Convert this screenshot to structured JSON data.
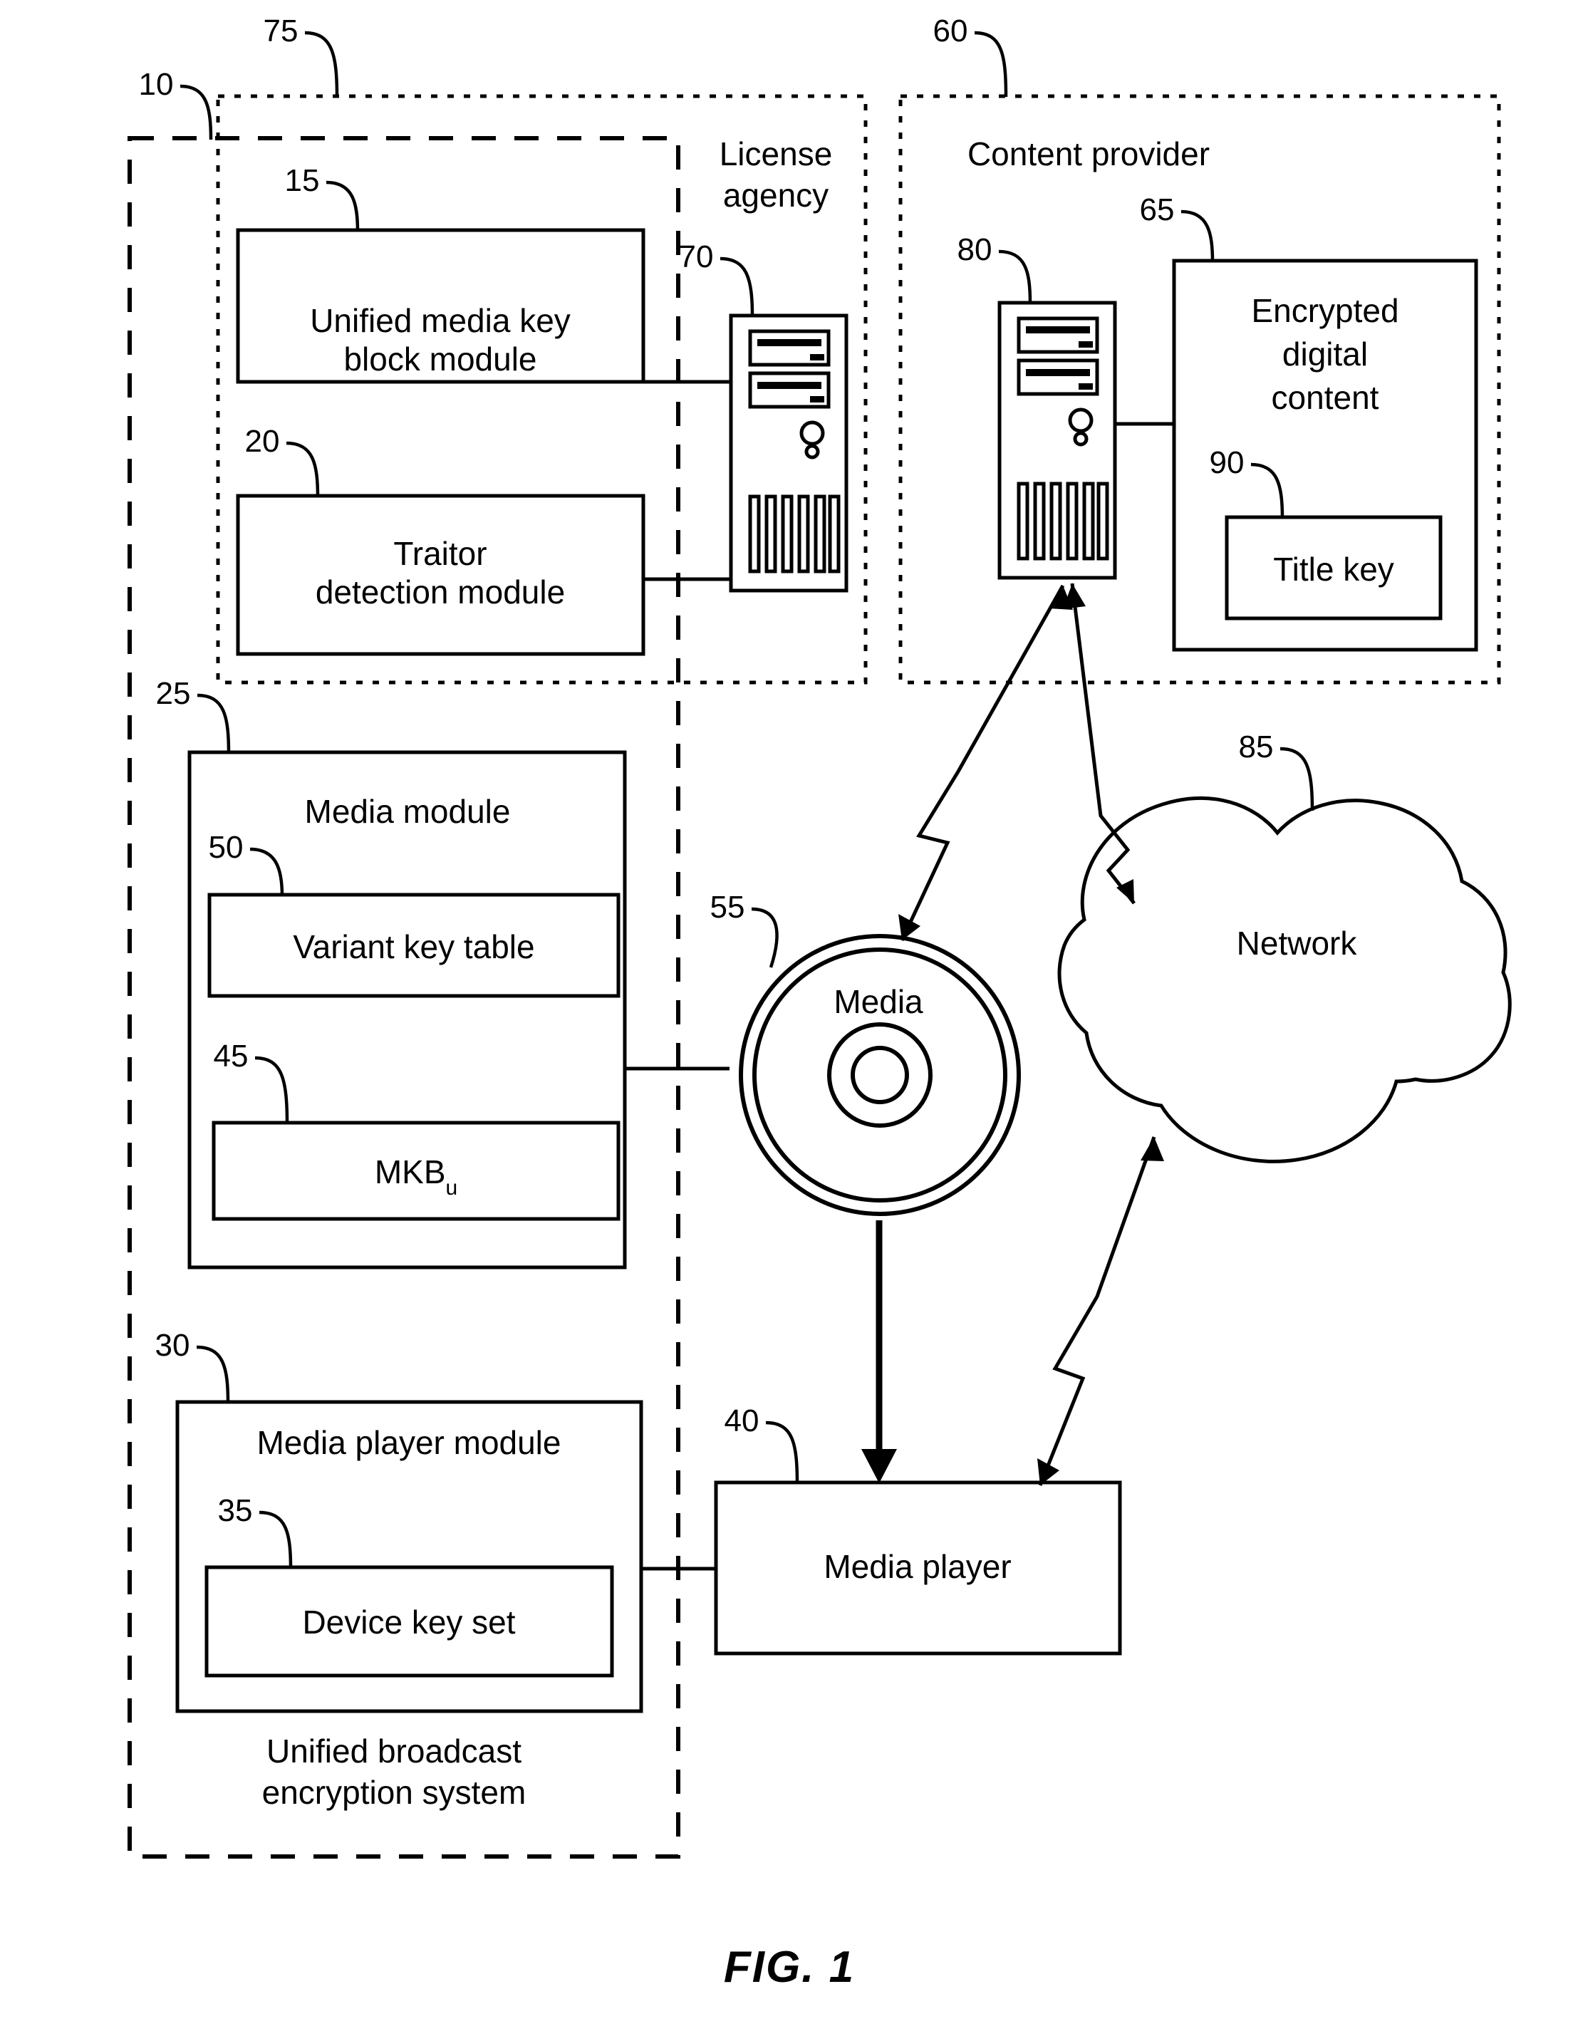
{
  "figure": {
    "caption": "FIG. 1"
  },
  "regions": {
    "system": {
      "ref": "10",
      "label_line1": "Unified broadcast",
      "label_line2": "encryption system"
    },
    "license_agency": {
      "ref": "75",
      "label_line1": "License",
      "label_line2": "agency"
    },
    "content_provider": {
      "ref": "60",
      "label": "Content provider"
    }
  },
  "boxes": {
    "umkb_module": {
      "ref": "15",
      "label_line1": "Unified media key",
      "label_line2": "block module"
    },
    "traitor_module": {
      "ref": "20",
      "label_line1": "Traitor",
      "label_line2": "detection module"
    },
    "media_module": {
      "ref": "25",
      "label": "Media module"
    },
    "variant_key_table": {
      "ref": "50",
      "label": "Variant key table"
    },
    "mkb": {
      "ref": "45",
      "label": "MKB",
      "subscript": "u"
    },
    "media_player_module": {
      "ref": "30",
      "label": "Media player module"
    },
    "device_key_set": {
      "ref": "35",
      "label": "Device key set"
    },
    "media_player": {
      "ref": "40",
      "label": "Media player"
    },
    "encrypted_content": {
      "ref": "65",
      "label_line1": "Encrypted",
      "label_line2": "digital",
      "label_line3": "content"
    },
    "title_key": {
      "ref": "90",
      "label": "Title key"
    }
  },
  "icons": {
    "license_server": {
      "ref": "70",
      "name": "server-tower-icon"
    },
    "provider_server": {
      "ref": "80",
      "name": "server-tower-icon"
    },
    "media_disc": {
      "ref": "55",
      "label": "Media",
      "name": "optical-disc-icon"
    },
    "network_cloud": {
      "ref": "85",
      "label": "Network",
      "name": "cloud-icon"
    }
  },
  "colors": {
    "ink": "#000000",
    "paper": "#ffffff"
  }
}
